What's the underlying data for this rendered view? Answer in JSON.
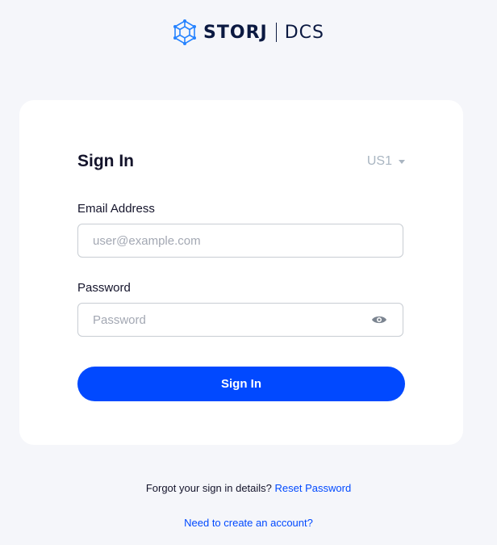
{
  "brand": {
    "name": "STORJ",
    "product": "DCS",
    "color": "#0149ff"
  },
  "signin": {
    "title": "Sign In",
    "region": "US1",
    "email_label": "Email Address",
    "email_placeholder": "user@example.com",
    "email_value": "",
    "password_label": "Password",
    "password_placeholder": "Password",
    "password_value": "",
    "button_label": "Sign In"
  },
  "footer": {
    "forgot_text": "Forgot your sign in details?",
    "reset_link": "Reset Password",
    "create_link": "Need to create an account?"
  },
  "icons": {
    "logo": "storj-logo-icon",
    "region_caret": "chevron-down-icon",
    "password_toggle": "eye-icon"
  }
}
